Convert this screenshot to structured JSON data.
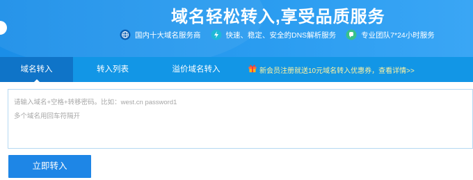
{
  "banner": {
    "title": "域名轻松转入,享受品质服务",
    "features": [
      {
        "icon": "globe-icon",
        "text": "国内十大域名服务商"
      },
      {
        "icon": "speed-icon",
        "text": "快速、稳定、安全的DNS解析服务"
      },
      {
        "icon": "support-icon",
        "text": "专业团队7*24小时服务"
      }
    ]
  },
  "tabs": [
    {
      "label": "域名转入",
      "active": true
    },
    {
      "label": "转入列表",
      "active": false
    },
    {
      "label": "溢价域名转入",
      "active": false
    }
  ],
  "promo": {
    "icon": "gift-icon",
    "text": "新会员注册就送10元域名转入优惠券，查看详情>>"
  },
  "input": {
    "placeholder_line1": "请输入域名+空格+转移密码。比如：west.cn  password1",
    "placeholder_line2": "多个域名用回车符隔开"
  },
  "submit": {
    "label": "立即转入"
  },
  "colors": {
    "banner": "#2196ee",
    "tab_bar": "#1296e6",
    "tab_active": "#0f74c8",
    "button": "#1e86e6",
    "promo_text": "#fff3a0"
  }
}
